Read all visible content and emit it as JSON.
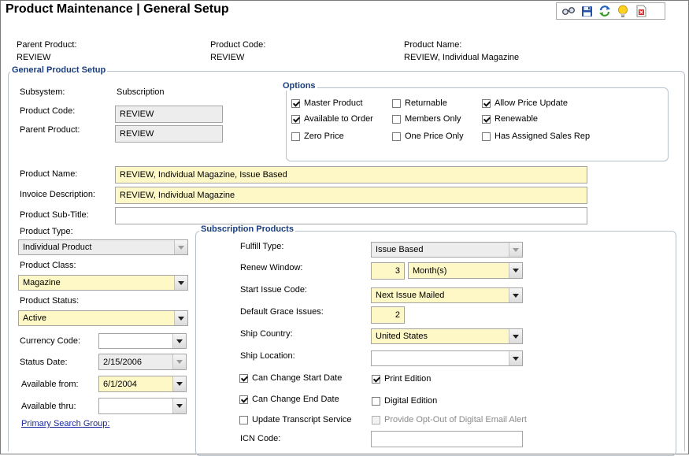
{
  "header": {
    "title": "Product Maintenance  |  General Setup",
    "toolbar_icons": [
      "glasses-icon",
      "save-icon",
      "refresh-icon",
      "lightbulb-icon",
      "delete-icon"
    ]
  },
  "summary": {
    "parent_product_label": "Parent Product:",
    "parent_product_value": "REVIEW",
    "product_code_label": "Product Code:",
    "product_code_value": "REVIEW",
    "product_name_label": "Product Name:",
    "product_name_value": "REVIEW,  Individual Magazine"
  },
  "general": {
    "title": "General Product Setup",
    "subsystem_label": "Subsystem:",
    "subsystem_value": "Subscription",
    "product_code_label": "Product Code:",
    "product_code_value": "REVIEW",
    "parent_product_label": "Parent Product:",
    "parent_product_value": "REVIEW",
    "product_name_label": "Product Name:",
    "product_name_value": "REVIEW,  Individual Magazine, Issue Based",
    "invoice_desc_label": "Invoice Description:",
    "invoice_desc_value": "REVIEW,  Individual Magazine",
    "subtitle_label": "Product Sub-Title:",
    "subtitle_value": "",
    "product_type_label": "Product Type:",
    "product_type_value": "Individual Product",
    "product_class_label": "Product Class:",
    "product_class_value": "Magazine",
    "product_status_label": "Product Status:",
    "product_status_value": "Active",
    "currency_label": "Currency Code:",
    "currency_value": "",
    "status_date_label": "Status Date:",
    "status_date_value": "2/15/2006",
    "avail_from_label": "Available from:",
    "avail_from_value": "6/1/2004",
    "avail_thru_label": "Available thru:",
    "avail_thru_value": "",
    "primary_search_link": "Primary Search Group:"
  },
  "options": {
    "title": "Options",
    "master_product": {
      "label": "Master Product",
      "checked": true
    },
    "available_to_order": {
      "label": "Available to Order",
      "checked": true
    },
    "zero_price": {
      "label": "Zero Price",
      "checked": false
    },
    "returnable": {
      "label": "Returnable",
      "checked": false
    },
    "members_only": {
      "label": "Members Only",
      "checked": false
    },
    "one_price_only": {
      "label": "One Price Only",
      "checked": false
    },
    "allow_price_update": {
      "label": "Allow Price Update",
      "checked": true
    },
    "renewable": {
      "label": "Renewable",
      "checked": true
    },
    "has_assigned_sales_rep": {
      "label": "Has Assigned Sales Rep",
      "checked": false
    }
  },
  "subscription": {
    "title": "Subscription Products",
    "fulfill_type_label": "Fulfill Type:",
    "fulfill_type_value": "Issue Based",
    "renew_window_label": "Renew Window:",
    "renew_window_value": "3",
    "renew_window_unit": "Month(s)",
    "start_issue_label": "Start Issue Code:",
    "start_issue_value": "Next Issue Mailed",
    "grace_label": "Default Grace Issues:",
    "grace_value": "2",
    "ship_country_label": "Ship Country:",
    "ship_country_value": "United States",
    "ship_location_label": "Ship Location:",
    "ship_location_value": "",
    "can_change_start": {
      "label": "Can Change Start Date",
      "checked": true
    },
    "can_change_end": {
      "label": "Can Change End Date",
      "checked": true
    },
    "update_transcript": {
      "label": "Update Transcript Service",
      "checked": false
    },
    "print_edition": {
      "label": "Print Edition",
      "checked": true
    },
    "digital_edition": {
      "label": "Digital Edition",
      "checked": false
    },
    "opt_out_digital": {
      "label": "Provide Opt-Out of Digital Email Alert",
      "checked": false
    },
    "icn_label": "ICN Code:",
    "icn_value": ""
  }
}
